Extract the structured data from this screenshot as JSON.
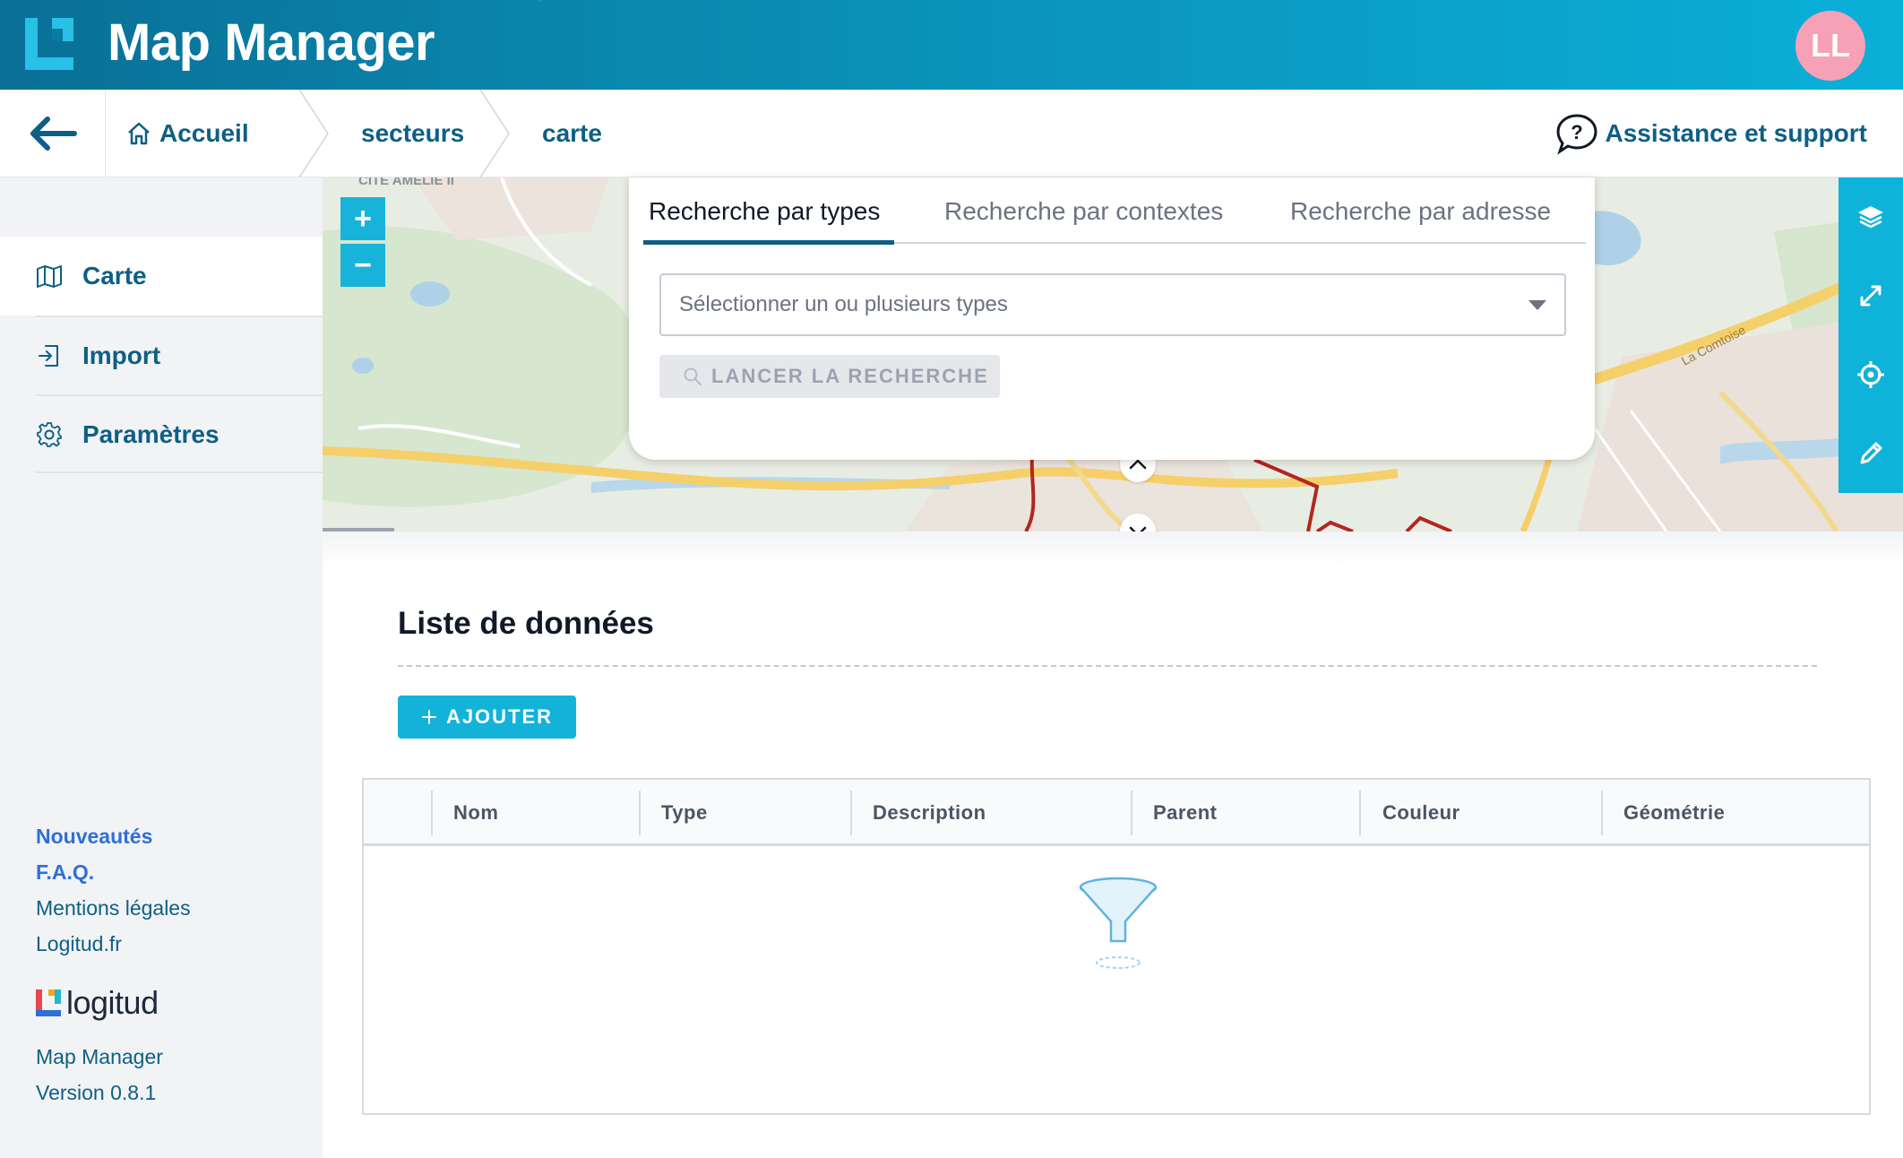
{
  "header": {
    "app_title": "Map Manager",
    "avatar_initials": "LL",
    "brand_color": "#0b9ec6",
    "avatar_color": "#f6a1b6"
  },
  "breadcrumb": {
    "back_icon": "arrow-left-icon",
    "home_icon": "home-icon",
    "items": [
      "Accueil",
      "secteurs",
      "carte"
    ],
    "support_label": "Assistance et support",
    "support_icon": "help-circle-icon"
  },
  "sidebar": {
    "nav": [
      {
        "label": "Carte",
        "icon": "map-icon",
        "active": true
      },
      {
        "label": "Import",
        "icon": "import-icon",
        "active": false
      },
      {
        "label": "Paramètres",
        "icon": "gear-icon",
        "active": false
      }
    ],
    "footer_links": [
      "Nouveautés",
      "F.A.Q.",
      "Mentions légales",
      "Logitud.fr"
    ],
    "brand_name": "logitud",
    "app_name": "Map Manager",
    "version": "Version 0.8.1"
  },
  "map": {
    "zoom_in": "+",
    "zoom_out": "−",
    "label_cite": "CITE AMELIE II",
    "label_road": "La Comtoise",
    "tools": [
      "layers-icon",
      "expand-icon",
      "crosshair-icon",
      "pencil-icon"
    ]
  },
  "search": {
    "tabs": [
      "Recherche par types",
      "Recherche par contextes",
      "Recherche par adresse"
    ],
    "active_tab": 0,
    "select_placeholder": "Sélectionner un ou plusieurs types",
    "search_button": "LANCER LA RECHERCHE"
  },
  "list": {
    "title": "Liste de données",
    "add_button": "AJOUTER",
    "columns": [
      "Nom",
      "Type",
      "Description",
      "Parent",
      "Couleur",
      "Géométrie"
    ],
    "rows": []
  },
  "colors": {
    "primary": "#0d5f85",
    "accent": "#13b3d9",
    "link_highlight": "#2f6fd6"
  }
}
